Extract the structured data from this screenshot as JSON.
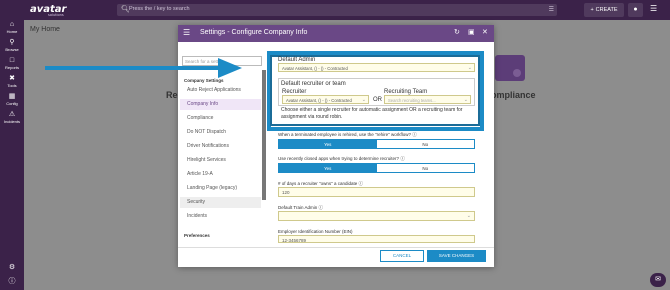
{
  "topbar": {
    "logo": "avatar",
    "logo_sub": "solutions",
    "search_placeholder": "Press the / key to search",
    "create_label": "CREATE"
  },
  "nav": [
    {
      "label": "Home",
      "icon": "home-icon"
    },
    {
      "label": "Browse",
      "icon": "search-icon"
    },
    {
      "label": "Reports",
      "icon": "folder-icon"
    },
    {
      "label": "Tools",
      "icon": "tools-icon"
    },
    {
      "label": "Config",
      "icon": "config-icon"
    },
    {
      "label": "Incidents",
      "icon": "incidents-icon"
    }
  ],
  "page": {
    "title": "My Home",
    "bg_text_left": "Re",
    "bg_text_right": "ompliance"
  },
  "modal": {
    "title": "Settings - Configure Company Info",
    "side_search_placeholder": "Search for a setting",
    "group_label": "Company Settings",
    "items": [
      "Auto Reject Applications",
      "Company Info",
      "Compliance",
      "Do NOT Dispatch",
      "Driver Notifications",
      "Hirelight Services",
      "Article 19-A",
      "Landing Page (legacy)",
      "Security",
      "Incidents"
    ],
    "preferences_label": "Preferences",
    "default_admin_label": "Default Admin",
    "default_admin_value": "Avatar Assistant, () - () - Contracted",
    "recruiter_team_label": "Default recruiter or team",
    "recruiter_label": "Recruiter",
    "recruiter_value": "Avatar Assistant, () - () - Contracted",
    "or_label": "OR",
    "team_label": "Recruiting Team",
    "team_placeholder": "Search recruiting teams...",
    "note": "Choose either a single recruiter for automatic assignment OR a recruiting team for assignment via round robin.",
    "q_rehire": "When a terminated employee is rehired, use the \"rehire\" workflow?",
    "q_closed_apps": "Use recently closed apps when trying to determine recruiter?",
    "yes": "Yes",
    "no": "No",
    "days_label": "# of days a recruiter \"owns\" a candidate",
    "days_value": "120",
    "train_admin_label": "Default Train Admin",
    "ein_label": "Employer Identification Number (EIN)",
    "ein_value": "12-3456789",
    "cancel": "CANCEL",
    "save": "SAVE CHANGES"
  },
  "colors": {
    "brand": "#3b2249",
    "modal_header": "#6a4886",
    "accent": "#1c8bc6"
  }
}
